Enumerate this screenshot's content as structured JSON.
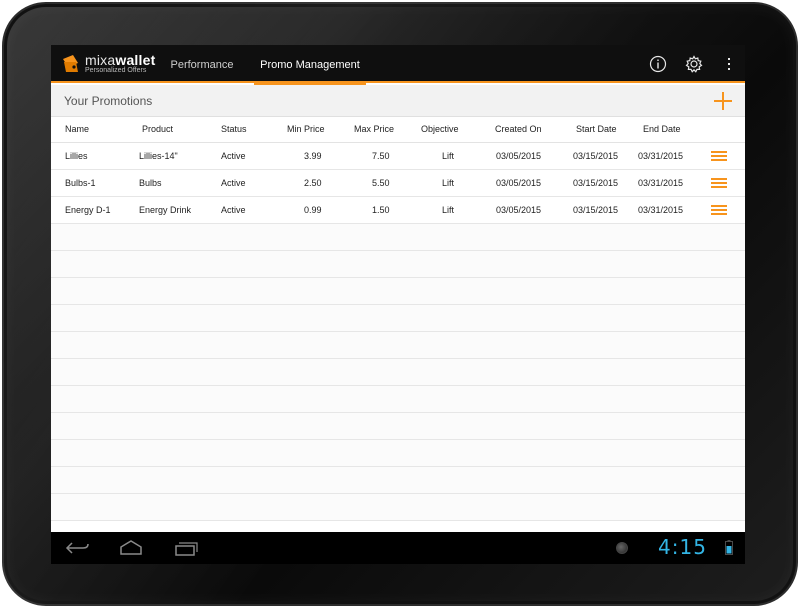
{
  "app": {
    "logo_light": "mixa",
    "logo_bold": "wallet",
    "logo_tagline": "Personalized Offers"
  },
  "nav": {
    "tabs": [
      {
        "label": "Performance",
        "active": false
      },
      {
        "label": "Promo Management",
        "active": true
      }
    ],
    "icons": [
      "info-icon",
      "gear-icon",
      "overflow-menu-icon"
    ]
  },
  "section": {
    "title": "Your Promotions",
    "add_icon": "plus-icon"
  },
  "table": {
    "columns": [
      "Name",
      "Product",
      "Status",
      "Min Price",
      "Max Price",
      "Objective",
      "Created On",
      "Start Date",
      "End Date"
    ],
    "rows": [
      [
        "Lillies",
        "Lillies-14\"",
        "Active",
        "3.99",
        "7.50",
        "Lift",
        "03/05/2015",
        "03/15/2015",
        "03/31/2015"
      ],
      [
        "Bulbs-1",
        "Bulbs",
        "Active",
        "2.50",
        "5.50",
        "Lift",
        "03/05/2015",
        "03/15/2015",
        "03/31/2015"
      ],
      [
        "Energy D-1",
        "Energy Drink",
        "Active",
        "0.99",
        "1.50",
        "Lift",
        "03/05/2015",
        "03/15/2015",
        "03/31/2015"
      ]
    ],
    "row_menu_icon": "drag-handle-icon"
  },
  "system_bar": {
    "icons": [
      "back-icon",
      "home-icon",
      "recent-apps-icon"
    ],
    "clock": "4:15"
  },
  "colors": {
    "accent": "#f7941d",
    "header_bg": "#0f0f0f",
    "clock": "#33b5e5"
  }
}
